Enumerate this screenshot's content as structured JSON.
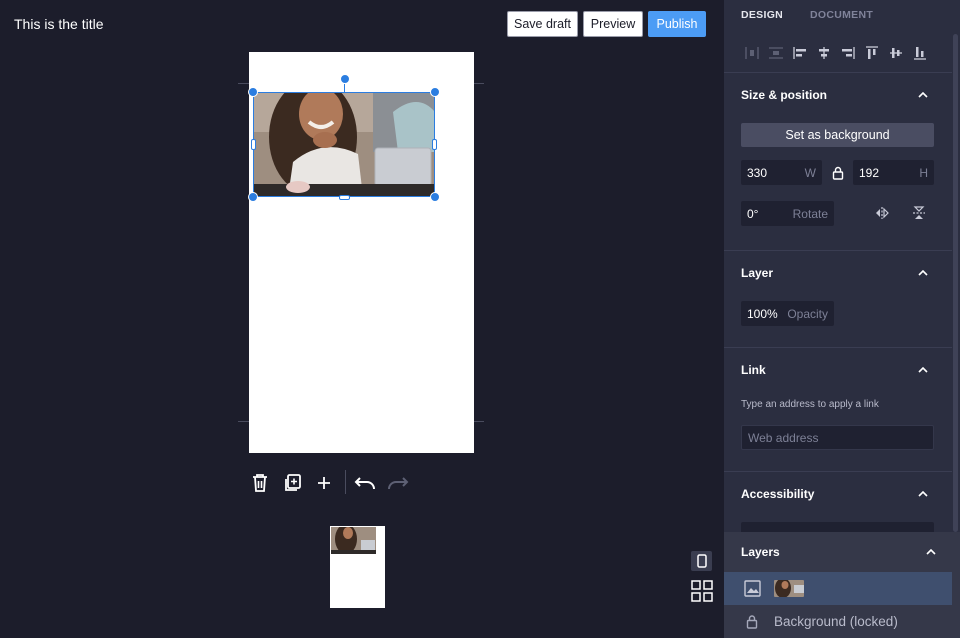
{
  "header": {
    "title": "This is the title",
    "save_draft_label": "Save draft",
    "preview_label": "Preview",
    "publish_label": "Publish"
  },
  "canvas": {
    "page_background": "#ffffff",
    "selection_color": "#2b7de0"
  },
  "toolbar": {
    "icons": [
      "trash-icon",
      "duplicate-icon",
      "plus-icon",
      "undo-icon",
      "redo-icon"
    ]
  },
  "panel": {
    "tabs": [
      {
        "label": "DESIGN",
        "active": true
      },
      {
        "label": "DOCUMENT",
        "active": false
      }
    ],
    "align_icons": [
      "distribute-horizontal-icon",
      "distribute-vertical-icon",
      "align-left-icon",
      "align-center-icon",
      "align-right-icon",
      "align-top-icon",
      "align-middle-icon",
      "align-bottom-icon"
    ],
    "size_position": {
      "title": "Size & position",
      "set_background_label": "Set as background",
      "width_value": "330",
      "width_suffix": "W",
      "height_value": "192",
      "height_suffix": "H",
      "rotate_value": "0°",
      "rotate_suffix": "Rotate"
    },
    "layer": {
      "title": "Layer",
      "opacity_value": "100%",
      "opacity_suffix": "Opacity"
    },
    "link": {
      "title": "Link",
      "help": "Type an address to apply a link",
      "placeholder": "Web address"
    },
    "accessibility": {
      "title": "Accessibility"
    }
  },
  "layers": {
    "title": "Layers",
    "background_label": "Background (locked)"
  },
  "colors": {
    "accent": "#4c9cf5",
    "bg": "#1c1d2b",
    "panel": "#2b2e40"
  }
}
